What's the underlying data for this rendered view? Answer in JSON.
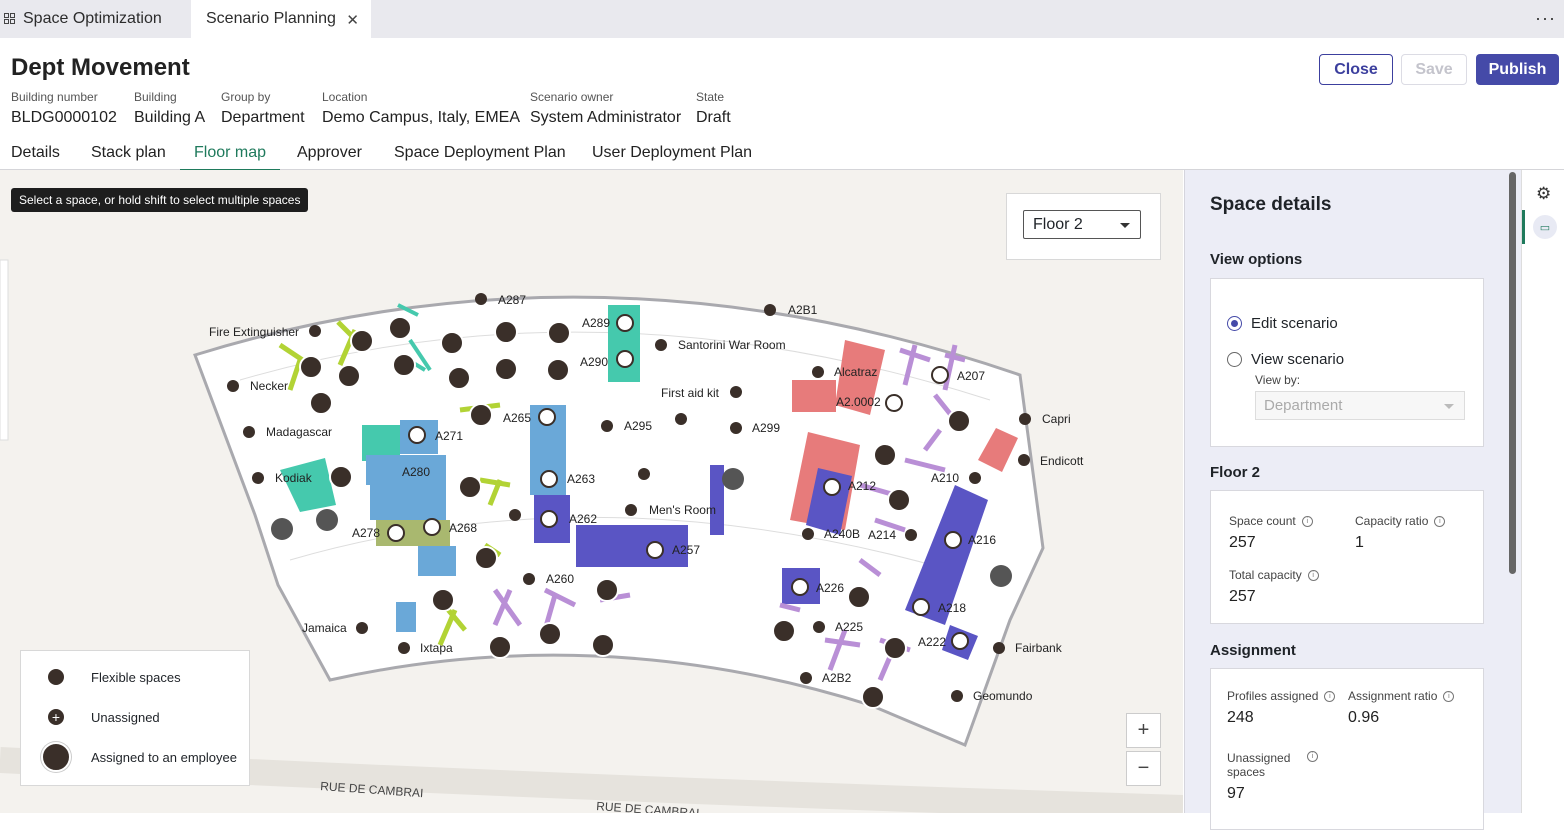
{
  "window_tabs": [
    {
      "label": "Space Optimization"
    },
    {
      "label": "Scenario Planning"
    }
  ],
  "header": {
    "title": "Dept Movement",
    "buttons": {
      "close": "Close",
      "save": "Save",
      "publish": "Publish"
    },
    "fields": [
      {
        "label": "Building number",
        "value": "BLDG0000102"
      },
      {
        "label": "Building",
        "value": "Building A"
      },
      {
        "label": "Group by",
        "value": "Department"
      },
      {
        "label": "Location",
        "value": "Demo Campus, Italy, EMEA"
      },
      {
        "label": "Scenario owner",
        "value": "System Administrator"
      },
      {
        "label": "State",
        "value": "Draft"
      }
    ]
  },
  "nav_tabs": [
    {
      "label": "Details"
    },
    {
      "label": "Stack plan"
    },
    {
      "label": "Floor map",
      "active": true
    },
    {
      "label": "Approver"
    },
    {
      "label": "Space Deployment Plan"
    },
    {
      "label": "User Deployment Plan"
    }
  ],
  "map": {
    "tooltip": "Select a space, or hold shift to select multiple spaces",
    "floor_select": "Floor 2",
    "zoom_in": "+",
    "zoom_out": "−",
    "streets": [
      "RUE DE CAMBRAI",
      "RUE DE CAMBRAI"
    ],
    "room_labels": [
      "A287",
      "A2B1",
      "Fire Extinguisher",
      "A289",
      "A290",
      "Santorini War Room",
      "Necker",
      "Alcatraz",
      "A207",
      "First aid kit",
      "A2.0002",
      "Capri",
      "Madagascar",
      "A271",
      "A265",
      "A295",
      "A299",
      "Endicott",
      "A280",
      "A263",
      "Kodiak",
      "A210",
      "A212",
      "Men's Room",
      "A262",
      "A278",
      "A268",
      "A240B",
      "A214",
      "A216",
      "A257",
      "A260",
      "A226",
      "A218",
      "Jamaica",
      "A225",
      "A222",
      "Fairbank",
      "Ixtapa",
      "A2B2",
      "Geomundo"
    ]
  },
  "legend": [
    {
      "icon": "flexible-space-icon",
      "label": "Flexible spaces"
    },
    {
      "icon": "unassigned-icon",
      "label": "Unassigned"
    },
    {
      "icon": "assigned-employee-icon",
      "label": "Assigned to an employee"
    }
  ],
  "panel": {
    "title": "Space details",
    "view_options": {
      "heading": "View options",
      "edit": "Edit scenario",
      "view": "View scenario",
      "view_by_label": "View by:",
      "view_by_value": "Department",
      "selected": "edit"
    },
    "floor": {
      "heading": "Floor 2",
      "space_count_label": "Space count",
      "space_count": "257",
      "capacity_ratio_label": "Capacity ratio",
      "capacity_ratio": "1",
      "total_capacity_label": "Total capacity",
      "total_capacity": "257"
    },
    "assignment": {
      "heading": "Assignment",
      "profiles_label": "Profiles assigned",
      "profiles": "248",
      "ratio_label": "Assignment ratio",
      "ratio": "0.96",
      "unassigned_label": "Unassigned spaces",
      "unassigned": "97"
    }
  },
  "colors": {
    "accent": "#454aa8",
    "active_tab": "#1f7a5c",
    "teal": "#45c9ad",
    "blue": "#6aa8d8",
    "indigo": "#5a55c4",
    "salmon": "#e77b7b",
    "lime": "#b2d335",
    "lavender": "#b98fd6",
    "olive": "#a9b86f"
  }
}
